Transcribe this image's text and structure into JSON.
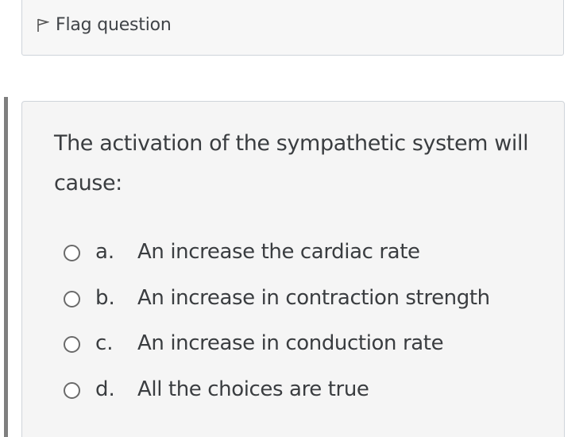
{
  "flag": {
    "label": "Flag question",
    "icon": "flag-icon"
  },
  "question": {
    "text": "The activation of the sympathetic system will cause:",
    "options": [
      {
        "letter": "a.",
        "text": "An increase the cardiac rate"
      },
      {
        "letter": "b.",
        "text": "An increase in contraction strength"
      },
      {
        "letter": "c.",
        "text": "An increase in conduction rate"
      },
      {
        "letter": "d.",
        "text": "All the choices are true"
      }
    ]
  }
}
